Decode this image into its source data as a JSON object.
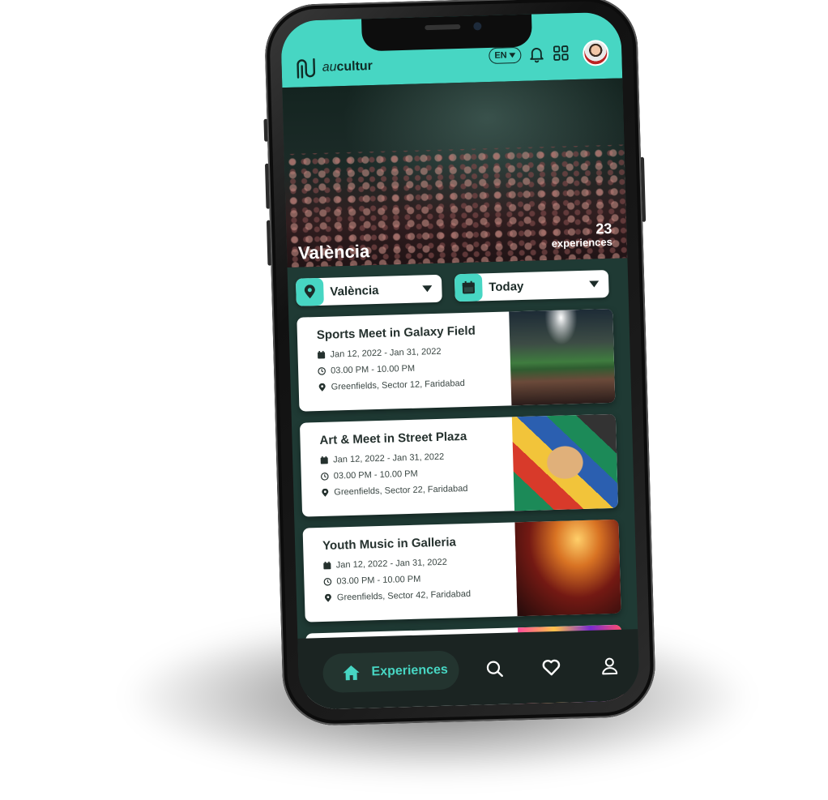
{
  "app": {
    "brand_prefix": "au",
    "brand_suffix": "cultur",
    "language": "EN"
  },
  "colors": {
    "accent": "#47d6c3",
    "dark_bg": "#1f3a34",
    "nav_bg": "#1b2422",
    "text_dark": "#25312e"
  },
  "icons": {
    "header": [
      "logo-icon",
      "bell-icon",
      "grid-icon",
      "avatar"
    ],
    "filters": [
      "location-pin-icon",
      "calendar-icon",
      "caret-down-icon"
    ],
    "card_rows": [
      "calendar-icon",
      "clock-icon",
      "location-pin-icon"
    ],
    "nav": [
      "home-icon",
      "search-icon",
      "heart-icon",
      "user-icon"
    ]
  },
  "hero": {
    "city": "València",
    "count": "23",
    "count_label": "experiences"
  },
  "filters": {
    "location": "València",
    "date": "Today"
  },
  "events": [
    {
      "title": "Sports Meet in Galaxy Field",
      "dates": "Jan 12, 2022 - Jan 31, 2022",
      "time": "03.00 PM - 10.00 PM",
      "location": "Greenfields, Sector 12, Faridabad"
    },
    {
      "title": "Art & Meet in Street Plaza",
      "dates": "Jan 12, 2022 - Jan 31, 2022",
      "time": "03.00 PM - 10.00 PM",
      "location": "Greenfields, Sector 22, Faridabad"
    },
    {
      "title": "Youth Music in Galleria",
      "dates": "Jan 12, 2022 - Jan 31, 2022",
      "time": "03.00 PM - 10.00 PM",
      "location": "Greenfields, Sector 42, Faridabad"
    }
  ],
  "nav": {
    "active_label": "Experiences"
  }
}
